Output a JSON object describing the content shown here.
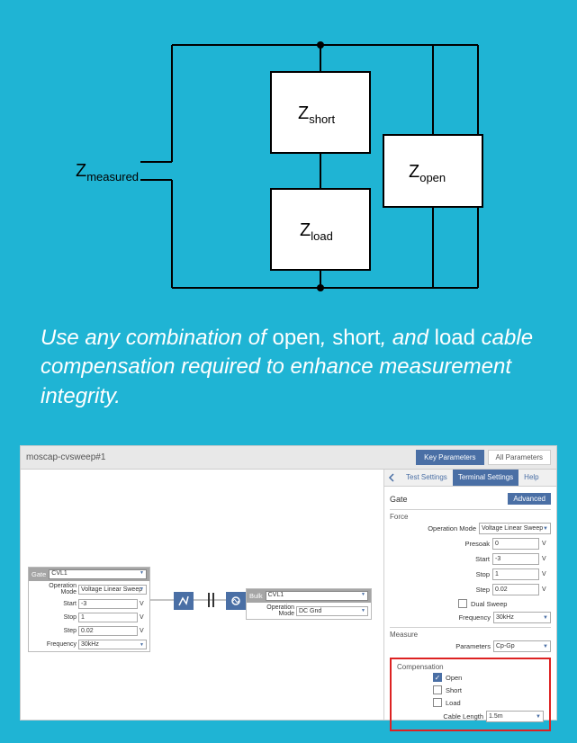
{
  "circuit": {
    "z_measured": "Z",
    "z_measured_sub": "measured",
    "z_short": "Z",
    "z_short_sub": "short",
    "z_load": "Z",
    "z_load_sub": "load",
    "z_open": "Z",
    "z_open_sub": "open"
  },
  "caption_parts": {
    "p1": "Use any combination of ",
    "p2": "open",
    "p3": ", ",
    "p4": "short",
    "p5": ", and ",
    "p6": "load",
    "p7": " cable compensation required to enhance measurement integrity."
  },
  "screenshot": {
    "title": "moscap-cvsweep#1",
    "key_params": "Key Parameters",
    "all_params": "All Parameters"
  },
  "left_block": {
    "head_label": "Gate",
    "head_value": "CVL1",
    "op_mode_label": "Operation Mode",
    "op_mode_value": "Voltage Linear Sweep",
    "start_label": "Start",
    "start_value": "-3",
    "stop_label": "Stop",
    "stop_value": "1",
    "step_label": "Step",
    "step_value": "0.02",
    "freq_label": "Frequency",
    "freq_value": "30kHz",
    "unit_v": "V"
  },
  "center_block": {
    "head_label": "Bulk",
    "head_value": "CVL1",
    "op_mode_label": "Operation Mode",
    "op_mode_value": "DC Gnd"
  },
  "right_panel": {
    "tab1": "Test Settings",
    "tab2": "Terminal Settings",
    "tab3": "Help",
    "gate": "Gate",
    "advanced": "Advanced",
    "force": "Force",
    "op_mode_label": "Operation Mode",
    "op_mode_value": "Voltage Linear Sweep",
    "presoak_label": "Presoak",
    "presoak_value": "0",
    "start_label": "Start",
    "start_value": "-3",
    "stop_label": "Stop",
    "stop_value": "1",
    "step_label": "Step",
    "step_value": "0.02",
    "dual_sweep": "Dual Sweep",
    "freq_label": "Frequency",
    "freq_value": "30kHz",
    "measure": "Measure",
    "params_label": "Parameters",
    "params_value": "Cp-Gp",
    "compensation": "Compensation",
    "open": "Open",
    "short": "Short",
    "load": "Load",
    "cable_length_label": "Cable Length",
    "cable_length_value": "1.5m",
    "unit_v": "V"
  }
}
